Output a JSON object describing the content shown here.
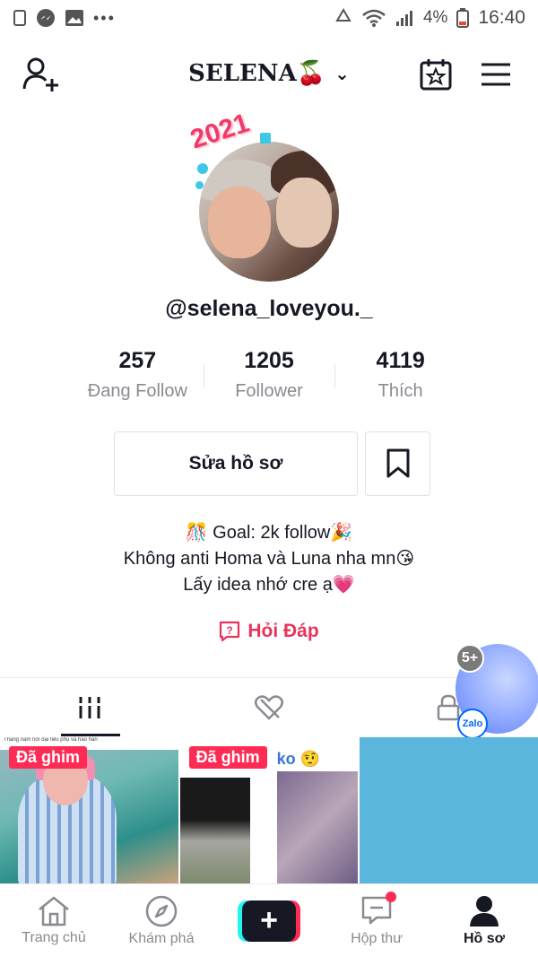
{
  "status_bar": {
    "time": "16:40",
    "battery": "4%"
  },
  "header": {
    "title": "SELENA🍒",
    "dropdown_glyph": "⌄"
  },
  "avatar": {
    "sticker": "2021"
  },
  "profile": {
    "username": "@selena_loveyou._"
  },
  "stats": [
    {
      "value": "257",
      "label": "Đang Follow"
    },
    {
      "value": "1205",
      "label": "Follower"
    },
    {
      "value": "4119",
      "label": "Thích"
    }
  ],
  "buttons": {
    "edit_profile": "Sửa hồ sơ"
  },
  "bio": {
    "line1": "🎊 Goal: 2k follow🎉",
    "line2": "Không anti Homa và Luna nha mn😘",
    "line3": "Lấy idea nhớ cre ạ💗"
  },
  "qa": {
    "label": "Hỏi Đáp"
  },
  "zalo": {
    "badge": "5+",
    "logo": "Zalo"
  },
  "grid": {
    "pinned_label": "Đã ghim",
    "cell1_caption": "Thẳng nam nơi đại tiểu phụ và háo hán",
    "cell2_caption": "ko 🤨"
  },
  "bottom_nav": [
    {
      "label": "Trang chủ"
    },
    {
      "label": "Khám phá"
    },
    {
      "label": "+"
    },
    {
      "label": "Hộp thư"
    },
    {
      "label": "Hồ sơ"
    }
  ]
}
